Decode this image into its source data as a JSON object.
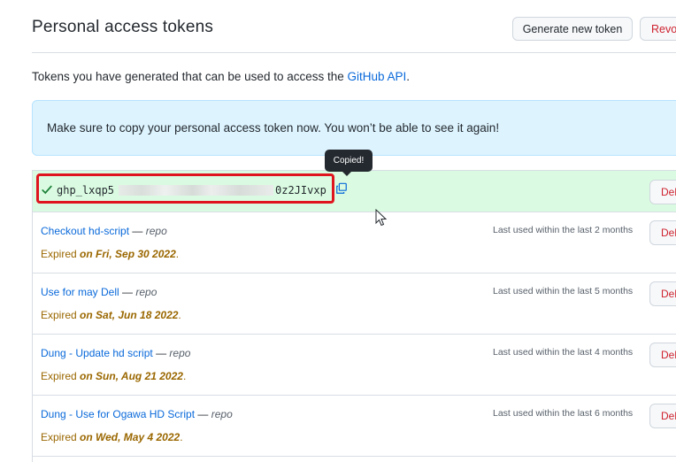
{
  "header": {
    "title": "Personal access tokens",
    "generate_label": "Generate new token",
    "revoke_label": "Revoke all"
  },
  "description": {
    "text_before": "Tokens you have generated that can be used to access the ",
    "link_text": "GitHub API",
    "text_after": "."
  },
  "flash": {
    "message": "Make sure to copy your personal access token now. You won’t be able to see it again!"
  },
  "new_token": {
    "prefix": "ghp_lxqp5",
    "suffix": "0z2JIvxp",
    "tooltip": "Copied!",
    "delete_label": "Delete"
  },
  "tokens": [
    {
      "name": "Checkout hd-script",
      "separator": " — ",
      "scope": "repo",
      "expired_label": "Expired ",
      "expired_date": "on Fri, Sep 30 2022",
      "end": ".",
      "last_used": "Last used within the last 2 months",
      "delete_label": "Delete"
    },
    {
      "name": "Use for may Dell",
      "separator": " — ",
      "scope": "repo",
      "expired_label": "Expired ",
      "expired_date": "on Sat, Jun 18 2022",
      "end": ".",
      "last_used": "Last used within the last 5 months",
      "delete_label": "Delete"
    },
    {
      "name": "Dung - Update hd script",
      "separator": " — ",
      "scope": "repo",
      "expired_label": "Expired ",
      "expired_date": "on Sun, Aug 21 2022",
      "end": ".",
      "last_used": "Last used within the last 4 months",
      "delete_label": "Delete"
    },
    {
      "name": "Dung - Use for Ogawa HD Script",
      "separator": " — ",
      "scope": "repo",
      "expired_label": "Expired ",
      "expired_date": "on Wed, May 4 2022",
      "end": ".",
      "last_used": "Last used within the last 6 months",
      "delete_label": "Delete"
    }
  ],
  "colors": {
    "link": "#0969da",
    "danger": "#cf222e",
    "warning_text": "#9a6700",
    "success_bg": "#dafbe1",
    "info_bg": "#ddf4ff",
    "highlight": "#e0141e"
  }
}
